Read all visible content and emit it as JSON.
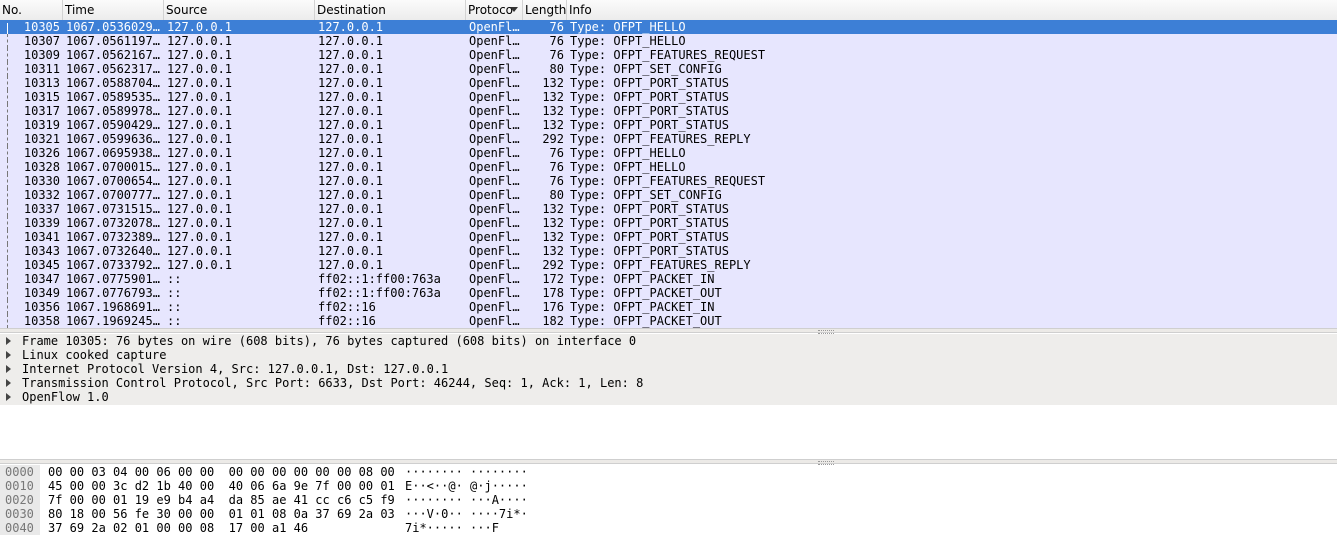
{
  "columns": {
    "no": "No.",
    "time": "Time",
    "source": "Source",
    "destination": "Destination",
    "protocol": "Protoco",
    "length": "Length",
    "info": "Info"
  },
  "packets": [
    {
      "no": "10305",
      "time": "1067.0536029…",
      "src": "127.0.0.1",
      "dst": "127.0.0.1",
      "proto": "OpenFl…",
      "len": "76",
      "info": "Type: OFPT_HELLO"
    },
    {
      "no": "10307",
      "time": "1067.0561197…",
      "src": "127.0.0.1",
      "dst": "127.0.0.1",
      "proto": "OpenFl…",
      "len": "76",
      "info": "Type: OFPT_HELLO"
    },
    {
      "no": "10309",
      "time": "1067.0562167…",
      "src": "127.0.0.1",
      "dst": "127.0.0.1",
      "proto": "OpenFl…",
      "len": "76",
      "info": "Type: OFPT_FEATURES_REQUEST"
    },
    {
      "no": "10311",
      "time": "1067.0562317…",
      "src": "127.0.0.1",
      "dst": "127.0.0.1",
      "proto": "OpenFl…",
      "len": "80",
      "info": "Type: OFPT_SET_CONFIG"
    },
    {
      "no": "10313",
      "time": "1067.0588704…",
      "src": "127.0.0.1",
      "dst": "127.0.0.1",
      "proto": "OpenFl…",
      "len": "132",
      "info": "Type: OFPT_PORT_STATUS"
    },
    {
      "no": "10315",
      "time": "1067.0589535…",
      "src": "127.0.0.1",
      "dst": "127.0.0.1",
      "proto": "OpenFl…",
      "len": "132",
      "info": "Type: OFPT_PORT_STATUS"
    },
    {
      "no": "10317",
      "time": "1067.0589978…",
      "src": "127.0.0.1",
      "dst": "127.0.0.1",
      "proto": "OpenFl…",
      "len": "132",
      "info": "Type: OFPT_PORT_STATUS"
    },
    {
      "no": "10319",
      "time": "1067.0590429…",
      "src": "127.0.0.1",
      "dst": "127.0.0.1",
      "proto": "OpenFl…",
      "len": "132",
      "info": "Type: OFPT_PORT_STATUS"
    },
    {
      "no": "10321",
      "time": "1067.0599636…",
      "src": "127.0.0.1",
      "dst": "127.0.0.1",
      "proto": "OpenFl…",
      "len": "292",
      "info": "Type: OFPT_FEATURES_REPLY"
    },
    {
      "no": "10326",
      "time": "1067.0695938…",
      "src": "127.0.0.1",
      "dst": "127.0.0.1",
      "proto": "OpenFl…",
      "len": "76",
      "info": "Type: OFPT_HELLO"
    },
    {
      "no": "10328",
      "time": "1067.0700015…",
      "src": "127.0.0.1",
      "dst": "127.0.0.1",
      "proto": "OpenFl…",
      "len": "76",
      "info": "Type: OFPT_HELLO"
    },
    {
      "no": "10330",
      "time": "1067.0700654…",
      "src": "127.0.0.1",
      "dst": "127.0.0.1",
      "proto": "OpenFl…",
      "len": "76",
      "info": "Type: OFPT_FEATURES_REQUEST"
    },
    {
      "no": "10332",
      "time": "1067.0700777…",
      "src": "127.0.0.1",
      "dst": "127.0.0.1",
      "proto": "OpenFl…",
      "len": "80",
      "info": "Type: OFPT_SET_CONFIG"
    },
    {
      "no": "10337",
      "time": "1067.0731515…",
      "src": "127.0.0.1",
      "dst": "127.0.0.1",
      "proto": "OpenFl…",
      "len": "132",
      "info": "Type: OFPT_PORT_STATUS"
    },
    {
      "no": "10339",
      "time": "1067.0732078…",
      "src": "127.0.0.1",
      "dst": "127.0.0.1",
      "proto": "OpenFl…",
      "len": "132",
      "info": "Type: OFPT_PORT_STATUS"
    },
    {
      "no": "10341",
      "time": "1067.0732389…",
      "src": "127.0.0.1",
      "dst": "127.0.0.1",
      "proto": "OpenFl…",
      "len": "132",
      "info": "Type: OFPT_PORT_STATUS"
    },
    {
      "no": "10343",
      "time": "1067.0732640…",
      "src": "127.0.0.1",
      "dst": "127.0.0.1",
      "proto": "OpenFl…",
      "len": "132",
      "info": "Type: OFPT_PORT_STATUS"
    },
    {
      "no": "10345",
      "time": "1067.0733792…",
      "src": "127.0.0.1",
      "dst": "127.0.0.1",
      "proto": "OpenFl…",
      "len": "292",
      "info": "Type: OFPT_FEATURES_REPLY"
    },
    {
      "no": "10347",
      "time": "1067.0775901…",
      "src": "::",
      "dst": "ff02::1:ff00:763a",
      "proto": "OpenFl…",
      "len": "172",
      "info": "Type: OFPT_PACKET_IN"
    },
    {
      "no": "10349",
      "time": "1067.0776793…",
      "src": "::",
      "dst": "ff02::1:ff00:763a",
      "proto": "OpenFl…",
      "len": "178",
      "info": "Type: OFPT_PACKET_OUT"
    },
    {
      "no": "10356",
      "time": "1067.1968691…",
      "src": "::",
      "dst": "ff02::16",
      "proto": "OpenFl…",
      "len": "176",
      "info": "Type: OFPT_PACKET_IN"
    },
    {
      "no": "10358",
      "time": "1067.1969245…",
      "src": "::",
      "dst": "ff02::16",
      "proto": "OpenFl…",
      "len": "182",
      "info": "Type: OFPT_PACKET_OUT"
    }
  ],
  "selected_index": 0,
  "details": [
    "Frame 10305: 76 bytes on wire (608 bits), 76 bytes captured (608 bits) on interface 0",
    "Linux cooked capture",
    "Internet Protocol Version 4, Src: 127.0.0.1, Dst: 127.0.0.1",
    "Transmission Control Protocol, Src Port: 6633, Dst Port: 46244, Seq: 1, Ack: 1, Len: 8",
    "OpenFlow 1.0"
  ],
  "bytes": [
    {
      "offset": "0000",
      "hex": "00 00 03 04 00 06 00 00  00 00 00 00 00 00 08 00",
      "ascii": "········ ········"
    },
    {
      "offset": "0010",
      "hex": "45 00 00 3c d2 1b 40 00  40 06 6a 9e 7f 00 00 01",
      "ascii": "E··<··@· @·j·····"
    },
    {
      "offset": "0020",
      "hex": "7f 00 00 01 19 e9 b4 a4  da 85 ae 41 cc c6 c5 f9",
      "ascii": "········ ···A····"
    },
    {
      "offset": "0030",
      "hex": "80 18 00 56 fe 30 00 00  01 01 08 0a 37 69 2a 03",
      "ascii": "···V·0·· ····7i*·"
    },
    {
      "offset": "0040",
      "hex": "37 69 2a 02 01 00 00 08  17 00 a1 46",
      "ascii": "7i*····· ···F"
    }
  ],
  "colors": {
    "row_bg": "#e7e6fe",
    "selected_bg": "#3d7fd6",
    "details_band": "#eeedeb"
  }
}
